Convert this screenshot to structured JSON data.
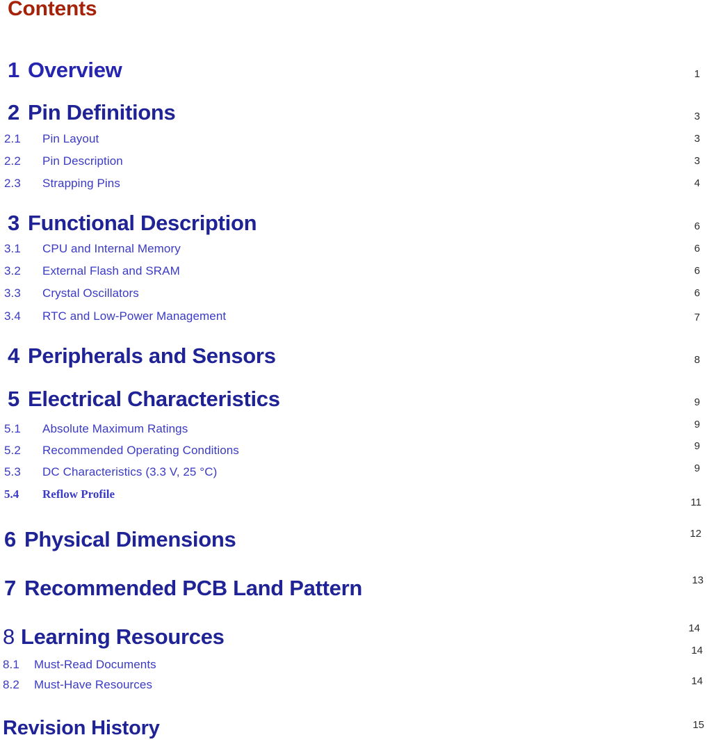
{
  "document": {
    "contents_heading": "Contents",
    "heading_color": "#a52208",
    "entry_color": "#1f2395",
    "subentry_color": "#3a3ac4",
    "page_number_color": "#2b2b2b"
  },
  "toc": {
    "entries": [
      {
        "number": "1",
        "title": "Overview",
        "page": "1"
      },
      {
        "number": "2",
        "title": "Pin Definitions",
        "page": "3"
      },
      {
        "number": "2.1",
        "title": "Pin Layout",
        "page": "3"
      },
      {
        "number": "2.2",
        "title": "Pin Description",
        "page": "3"
      },
      {
        "number": "2.3",
        "title": "Strapping Pins",
        "page": "4"
      },
      {
        "number": "3",
        "title": "Functional Description",
        "page": "6"
      },
      {
        "number": "3.1",
        "title": "CPU and Internal Memory",
        "page": "6"
      },
      {
        "number": "3.2",
        "title": "External Flash and SRAM",
        "page": "6"
      },
      {
        "number": "3.3",
        "title": "Crystal Oscillators",
        "page": "6"
      },
      {
        "number": "3.4",
        "title": "RTC and Low-Power Management",
        "page": "7"
      },
      {
        "number": "4",
        "title": "Peripherals and Sensors",
        "page": "8"
      },
      {
        "number": "5",
        "title": "Electrical Characteristics",
        "page": "9"
      },
      {
        "number": "5.1",
        "title": "Absolute Maximum Ratings",
        "page": "9"
      },
      {
        "number": "5.2",
        "title": "Recommended Operating Conditions",
        "page": "9"
      },
      {
        "number": "5.3",
        "title": "DC Characteristics (3.3 V, 25 °C)",
        "page": "9"
      },
      {
        "number": "5.4",
        "title": "Reflow Profile",
        "page": "11"
      },
      {
        "number": "6",
        "title": "Physical Dimensions",
        "page": "12"
      },
      {
        "number": "7",
        "title": "Recommended PCB Land Pattern",
        "page": "13"
      },
      {
        "number": "8",
        "title": "Learning Resources",
        "page": "14"
      },
      {
        "number": "8.1",
        "title": "Must-Read Documents",
        "page": "14"
      },
      {
        "number": "8.2",
        "title": "Must-Have Resources",
        "page": "14"
      },
      {
        "number": "",
        "title": "Revision History",
        "page": "15"
      }
    ]
  }
}
